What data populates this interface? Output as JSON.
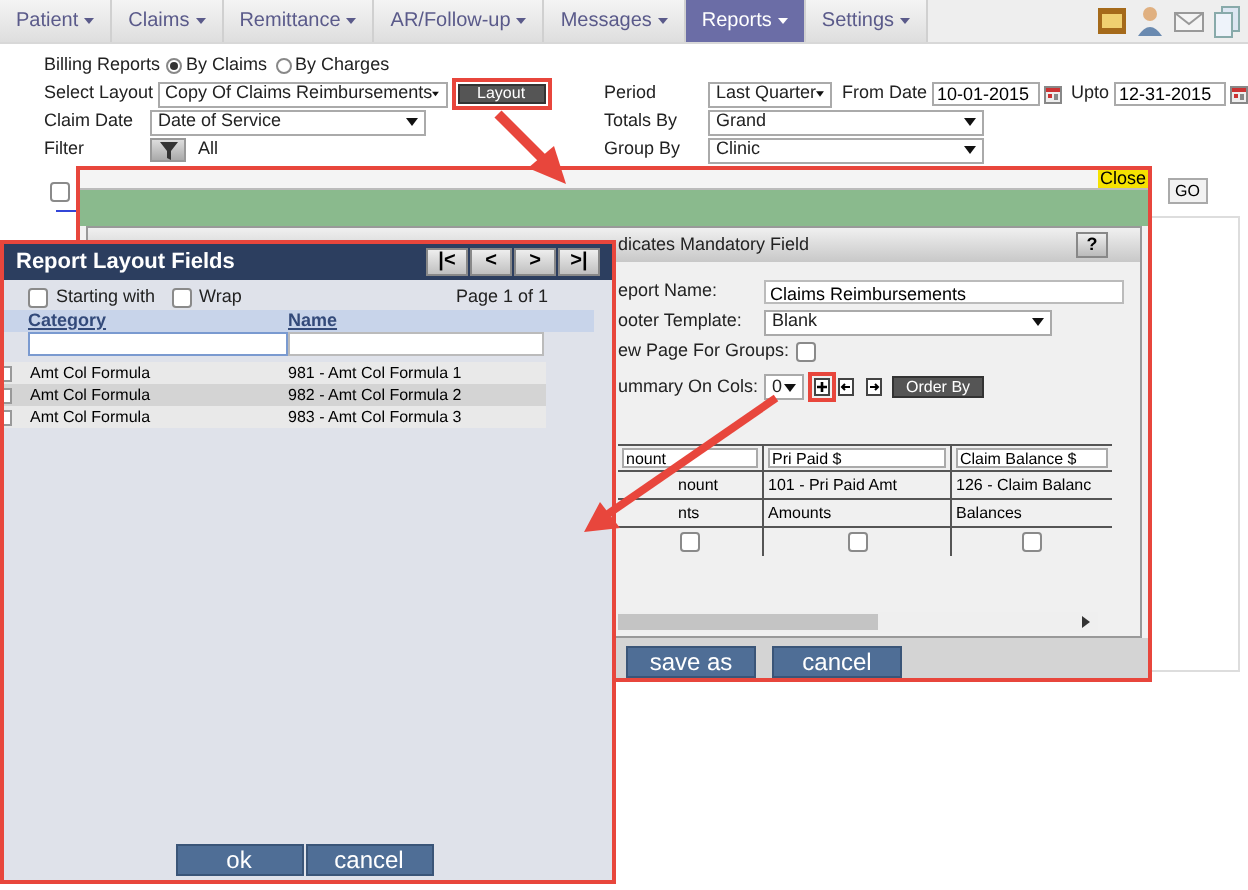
{
  "nav": {
    "tabs": [
      {
        "label": "Patient",
        "selected": false
      },
      {
        "label": "Claims",
        "selected": false
      },
      {
        "label": "Remittance",
        "selected": false
      },
      {
        "label": "AR/Follow-up",
        "selected": false
      },
      {
        "label": "Messages",
        "selected": false
      },
      {
        "label": "Reports",
        "selected": true
      },
      {
        "label": "Settings",
        "selected": false
      }
    ]
  },
  "form": {
    "billing_reports": {
      "label": "Billing Reports",
      "options": [
        {
          "label": "By Claims",
          "selected": true
        },
        {
          "label": "By Charges",
          "selected": false
        }
      ]
    },
    "select_layout": {
      "label": "Select Layout",
      "value": "Copy Of Claims Reimbursements",
      "button": "Layout"
    },
    "claim_date": {
      "label": "Claim Date",
      "value": "Date of Service"
    },
    "filter": {
      "label": "Filter",
      "value": "All"
    },
    "period": {
      "label": "Period",
      "value": "Last Quarter"
    },
    "from_date": {
      "label": "From Date",
      "value": "10-01-2015"
    },
    "upto": {
      "label": "Upto",
      "value": "12-31-2015"
    },
    "totals_by": {
      "label": "Totals By",
      "value": "Grand"
    },
    "group_by": {
      "label": "Group By",
      "value": "Clinic"
    },
    "select_all": {
      "checked": false
    },
    "go_button": "GO"
  },
  "layout_dialog": {
    "close": "Close",
    "header": "dicates Mandatory Field",
    "help": "?",
    "report_name": {
      "label": "eport Name:",
      "value": "Claims Reimbursements"
    },
    "footer_template": {
      "label": "ooter Template:",
      "value": "Blank"
    },
    "new_page_for_groups": {
      "label": "ew Page For Groups:",
      "checked": false
    },
    "summary_on_cols": {
      "label": "ummary On Cols:",
      "value": "0"
    },
    "order_by": "Order By",
    "columns": [
      {
        "title": "nount",
        "field": "nount",
        "category": "nts",
        "checked": false
      },
      {
        "title": "Pri Paid $",
        "field": "101 - Pri Paid Amt",
        "category": "Amounts",
        "checked": false
      },
      {
        "title": "Claim Balance $",
        "field": "126 - Claim Balanc",
        "category": "Balances",
        "checked": false
      }
    ],
    "buttons": [
      "save as",
      "cancel"
    ]
  },
  "fields_panel": {
    "title": "Report Layout Fields",
    "pager": [
      "|<",
      "<",
      ">",
      ">|"
    ],
    "starting_with": {
      "label": "Starting with",
      "checked": false
    },
    "wrap": {
      "label": "Wrap",
      "checked": false
    },
    "page": "Page 1 of 1",
    "columns": [
      "Category",
      "Name"
    ],
    "rows": [
      {
        "category": "Amt Col Formula",
        "name": "981 - Amt Col Formula 1",
        "selected": false
      },
      {
        "category": "Amt Col Formula",
        "name": "982 - Amt Col Formula 2",
        "selected": true
      },
      {
        "category": "Amt Col Formula",
        "name": "983 - Amt Col Formula 3",
        "selected": false
      }
    ],
    "buttons": [
      "ok",
      "cancel"
    ]
  }
}
